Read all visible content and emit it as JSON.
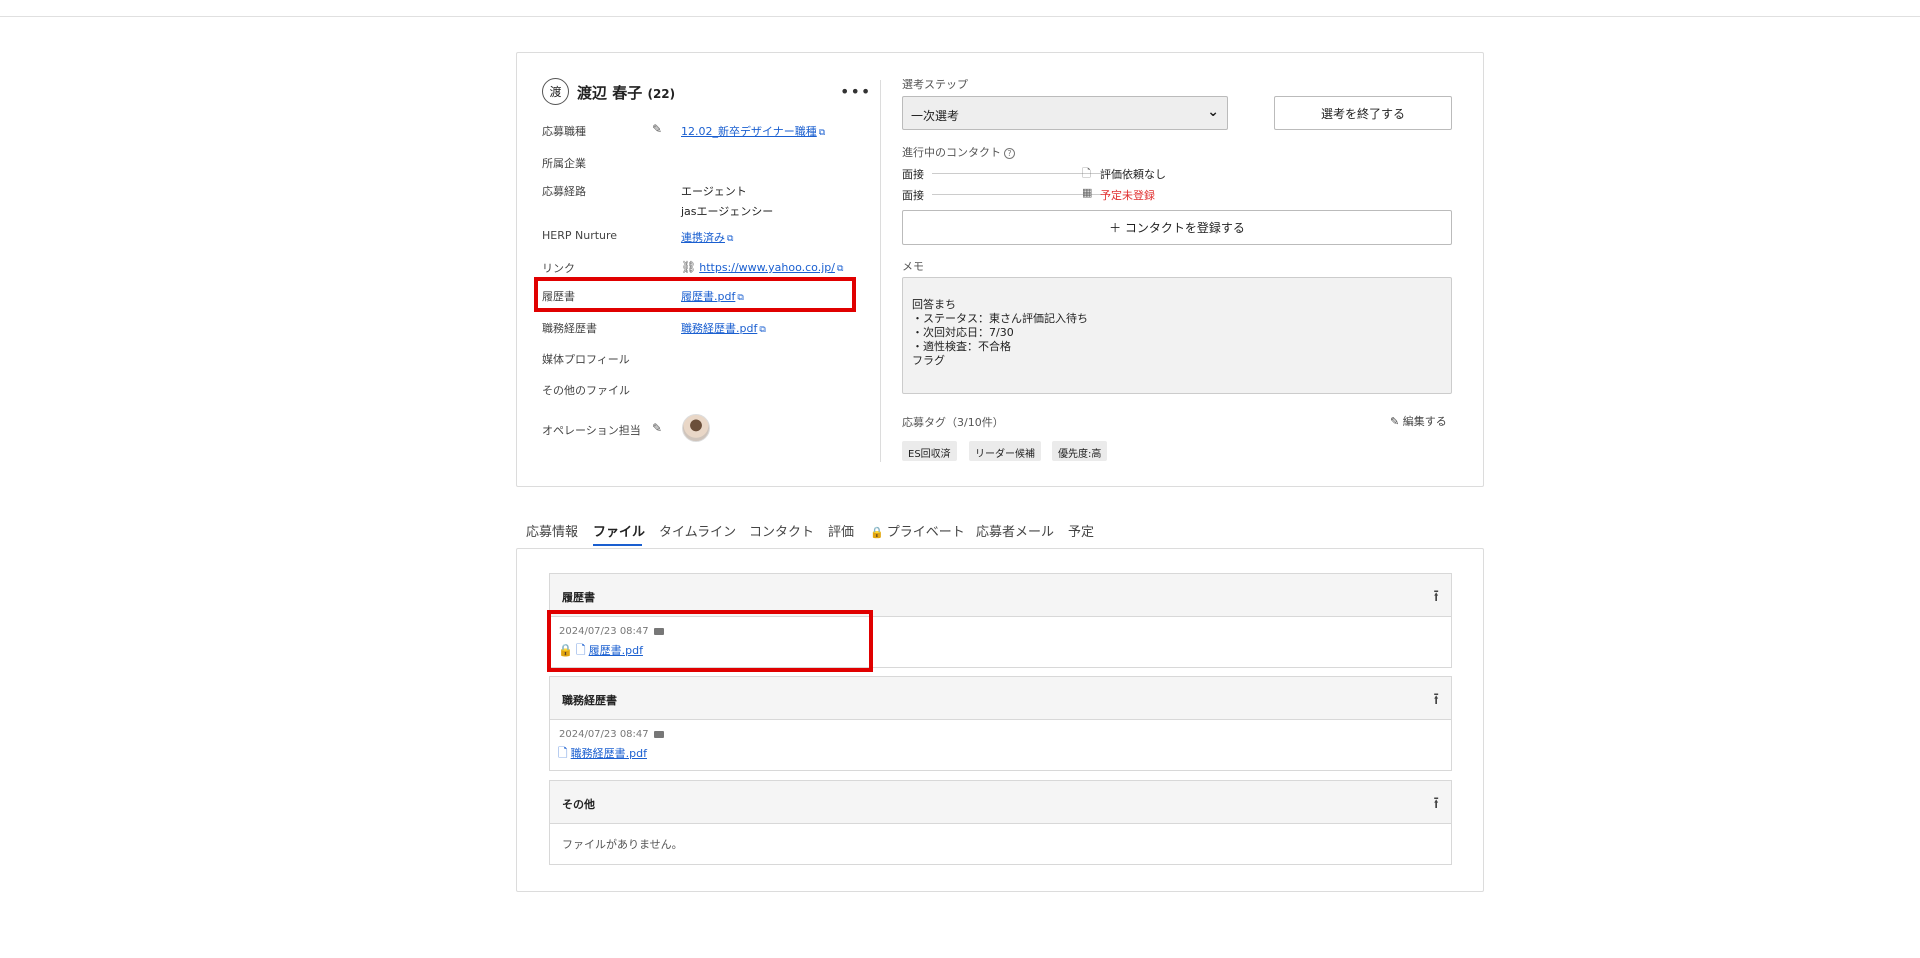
{
  "candidate": {
    "avatar_char": "渡",
    "name": "渡辺 春子",
    "age": "(22)",
    "more": "•••"
  },
  "fields": {
    "position_label": "応募職種",
    "position_value": "12.02_新卒デザイナー職種",
    "company_label": "所属企業",
    "route_label": "応募経路",
    "route_value_1": "エージェント",
    "route_value_2": "jasエージェンシー",
    "nurture_label": "HERP Nurture",
    "nurture_value": "連携済み",
    "link_label": "リンク",
    "link_value": "https://www.yahoo.co.jp/",
    "resume_label": "履歴書",
    "resume_value": "履歴書.pdf",
    "cv_label": "職務経歴書",
    "cv_value": "職務経歴書.pdf",
    "media_label": "媒体プロフィール",
    "other_files_label": "その他のファイル",
    "operator_label": "オペレーション担当"
  },
  "selection": {
    "step_label": "選考ステップ",
    "step_value": "一次選考",
    "end_button": "選考を終了する",
    "contacts_label": "進行中のコンタクト",
    "contacts": [
      {
        "type": "面接",
        "status": "評価依頼なし",
        "icon": "document-icon"
      },
      {
        "type": "面接",
        "status": "予定未登録",
        "icon": "calendar-icon"
      }
    ],
    "register_button": "＋ コンタクトを登録する",
    "memo_label": "メモ",
    "memo_lines": [
      "回答まち",
      "・ステータス：東さん評価記入待ち",
      "・次回対応日：7/30",
      "・適性検査：不合格",
      "フラグ"
    ],
    "tags_label": "応募タグ（3/10件）",
    "edit_tags": "編集する",
    "tags": [
      "ES回収済",
      "リーダー候補",
      "優先度:高"
    ]
  },
  "tabs": [
    "応募情報",
    "ファイル",
    "タイムライン",
    "コンタクト",
    "評価",
    "プライベート",
    "応募者メール",
    "予定"
  ],
  "files": {
    "resume_title": "履歴書",
    "resume_date": "2024/07/23 08:47",
    "resume_file": "履歴書.pdf",
    "cv_title": "職務経歴書",
    "cv_date": "2024/07/23 08:47",
    "cv_file": "職務経歴書.pdf",
    "other_title": "その他",
    "no_files": "ファイルがありません。"
  },
  "colors": {
    "link": "#1a5fd0",
    "highlight": "#e00000",
    "warning": "#e03030"
  }
}
